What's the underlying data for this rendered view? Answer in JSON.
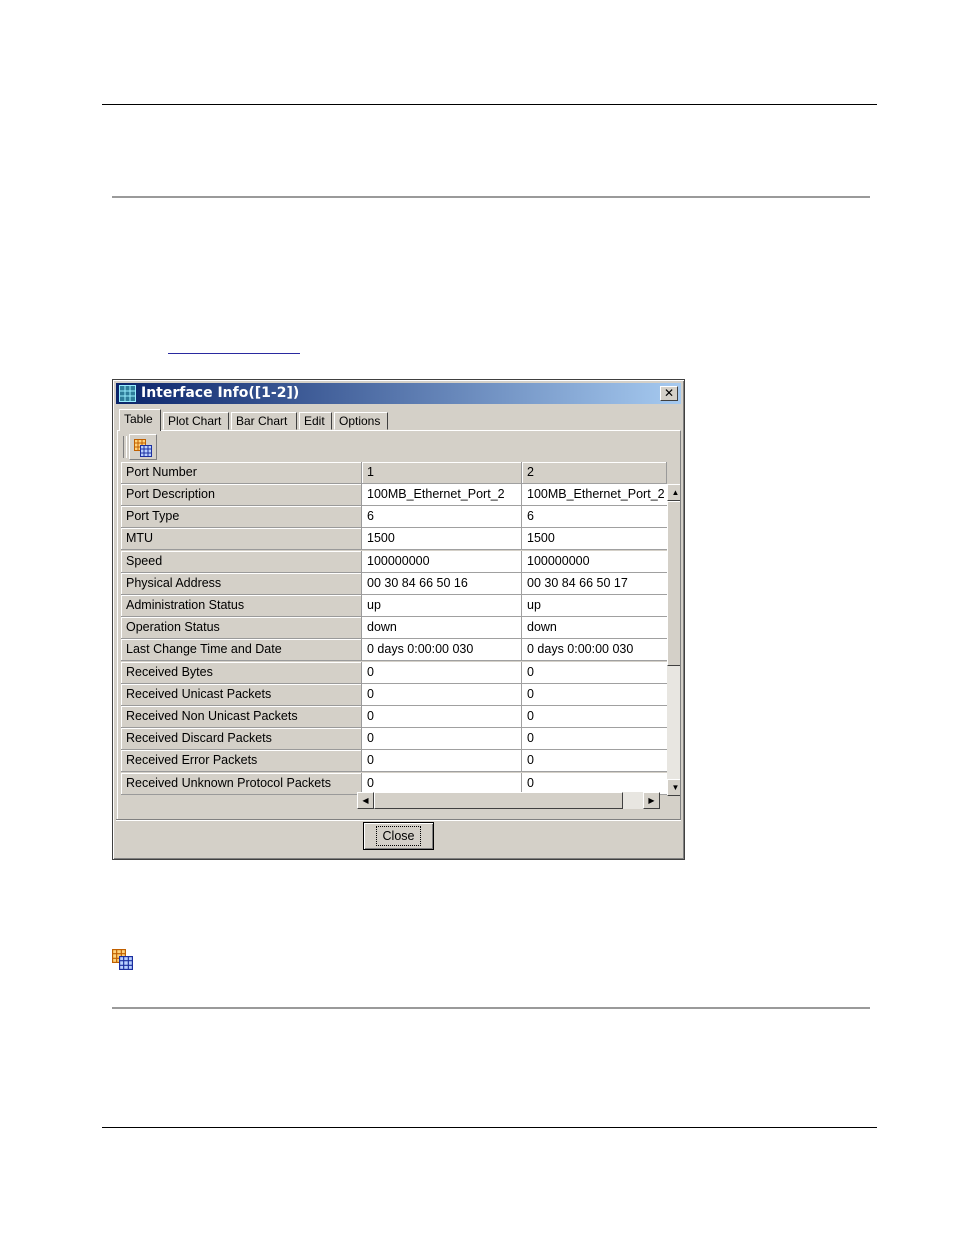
{
  "dialog": {
    "title": "Interface Info([1-2])",
    "close_glyph": "✕",
    "tabs": [
      {
        "label": "Table",
        "active": true
      },
      {
        "label": "Plot Chart",
        "active": false
      },
      {
        "label": "Bar Chart",
        "active": false
      },
      {
        "label": "Edit",
        "active": false
      },
      {
        "label": "Options",
        "active": false
      }
    ],
    "toolbar_icon": "table-grid-icon",
    "table": {
      "header": {
        "label": "Port Number",
        "col1": "1",
        "col2": "2"
      },
      "rows": [
        {
          "label": "Port Description",
          "col1": "100MB_Ethernet_Port_2",
          "col2": "100MB_Ethernet_Port_2"
        },
        {
          "label": "Port Type",
          "col1": "6",
          "col2": "6"
        },
        {
          "label": "MTU",
          "col1": "1500",
          "col2": "1500"
        },
        {
          "label": "Speed",
          "col1": "100000000",
          "col2": "100000000"
        },
        {
          "label": "Physical Address",
          "col1": "00 30 84 66 50 16",
          "col2": "00 30 84 66 50 17"
        },
        {
          "label": "Administration Status",
          "col1": "up",
          "col2": "up"
        },
        {
          "label": "Operation Status",
          "col1": "down",
          "col2": "down"
        },
        {
          "label": "Last Change Time and Date",
          "col1": "0 days 0:00:00 030",
          "col2": "0 days 0:00:00 030"
        },
        {
          "label": "Received Bytes",
          "col1": "0",
          "col2": "0"
        },
        {
          "label": "Received Unicast Packets",
          "col1": "0",
          "col2": "0"
        },
        {
          "label": "Received Non Unicast Packets",
          "col1": "0",
          "col2": "0"
        },
        {
          "label": "Received Discard Packets",
          "col1": "0",
          "col2": "0"
        },
        {
          "label": "Received Error Packets",
          "col1": "0",
          "col2": "0"
        },
        {
          "label": "Received Unknown Protocol Packets",
          "col1": "0",
          "col2": "0"
        }
      ]
    },
    "close_button_label": "Close"
  },
  "colors": {
    "titlebar_start": "#0a246a",
    "titlebar_end": "#a6caf0",
    "window_face": "#d4d0c8"
  }
}
